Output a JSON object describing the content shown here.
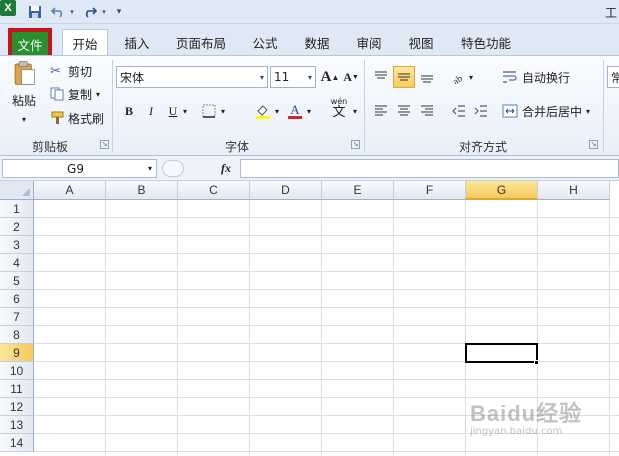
{
  "window": {
    "title": "工"
  },
  "tabs": [
    {
      "id": "file",
      "label": "文件"
    },
    {
      "id": "home",
      "label": "开始"
    },
    {
      "id": "insert",
      "label": "插入"
    },
    {
      "id": "page_layout",
      "label": "页面布局"
    },
    {
      "id": "formulas",
      "label": "公式"
    },
    {
      "id": "data",
      "label": "数据"
    },
    {
      "id": "review",
      "label": "审阅"
    },
    {
      "id": "view",
      "label": "视图"
    },
    {
      "id": "special",
      "label": "特色功能"
    }
  ],
  "ribbon": {
    "clipboard": {
      "label": "剪贴板",
      "paste": "粘贴",
      "cut": "剪切",
      "copy": "复制",
      "format_painter": "格式刷"
    },
    "font": {
      "label": "字体",
      "font_name": "宋体",
      "font_size": "11",
      "bold": "B",
      "italic": "I",
      "underline": "U",
      "phonetic": "wén",
      "phonetic_char": "文"
    },
    "alignment": {
      "label": "对齐方式",
      "wrap_text": "自动换行",
      "merge_center": "合并后居中"
    },
    "number": {
      "partial_label": "常"
    }
  },
  "formula_bar": {
    "name_box": "G9",
    "fx": "fx",
    "value": ""
  },
  "grid": {
    "columns": [
      "A",
      "B",
      "C",
      "D",
      "E",
      "F",
      "G",
      "H"
    ],
    "rows": [
      "1",
      "2",
      "3",
      "4",
      "5",
      "6",
      "7",
      "8",
      "9",
      "10",
      "11",
      "12",
      "13",
      "14"
    ],
    "active_column": "G",
    "active_row": "9"
  },
  "watermark": {
    "main": "Baidu经验",
    "sub": "jingyan.baidu.com"
  },
  "colors": {
    "file_tab": "#2a8f2f",
    "highlight_box": "#c3151b",
    "ribbon_bg": "#dfe9f5",
    "active_header": "#f7c95c"
  }
}
